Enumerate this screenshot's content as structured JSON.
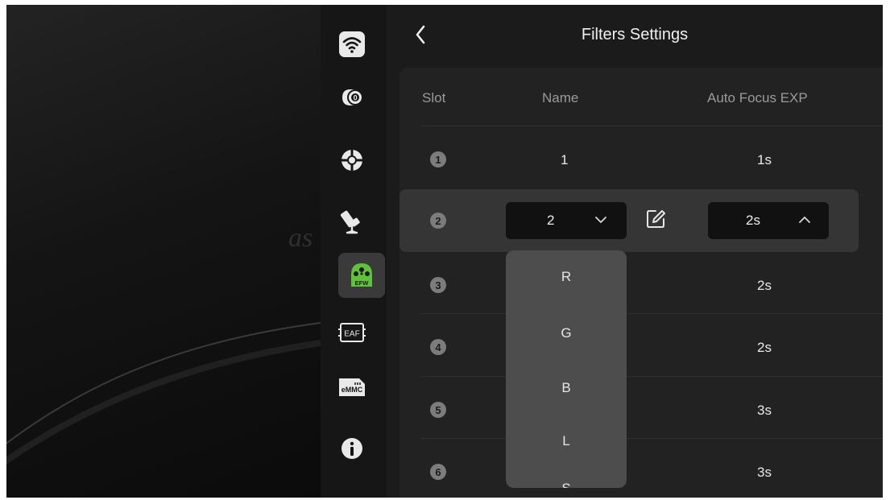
{
  "header": {
    "title": "Filters Settings"
  },
  "table": {
    "columns": [
      "Slot",
      "Name",
      "Auto Focus EXP"
    ],
    "rows": [
      {
        "slot": "1",
        "name": "1",
        "exp": "1s"
      },
      {
        "slot": "2",
        "name": "2",
        "exp": "2s"
      },
      {
        "slot": "3",
        "name": "",
        "exp": "2s"
      },
      {
        "slot": "4",
        "name": "",
        "exp": "2s"
      },
      {
        "slot": "5",
        "name": "",
        "exp": "3s"
      },
      {
        "slot": "6",
        "name": "",
        "exp": "3s"
      }
    ],
    "selected_row": {
      "slot": "2",
      "name_select_value": "2",
      "exp_select_value": "2s"
    }
  },
  "dropdown": {
    "options": [
      "R",
      "G",
      "B",
      "L",
      "S"
    ]
  },
  "sidebar": {
    "items": [
      {
        "icon": "wifi-icon"
      },
      {
        "icon": "camera-icon"
      },
      {
        "icon": "guide-icon"
      },
      {
        "icon": "telescope-mount-icon"
      },
      {
        "icon": "efw-icon",
        "label": "EFW",
        "active": true
      },
      {
        "icon": "eaf-icon",
        "label": "EAF"
      },
      {
        "icon": "emmc-icon",
        "label": "eMMC"
      },
      {
        "icon": "info-icon"
      }
    ]
  },
  "colors": {
    "accent": "#5fc23a",
    "panel": "#1b1b1b",
    "dropdown": "#4d4d4d"
  }
}
